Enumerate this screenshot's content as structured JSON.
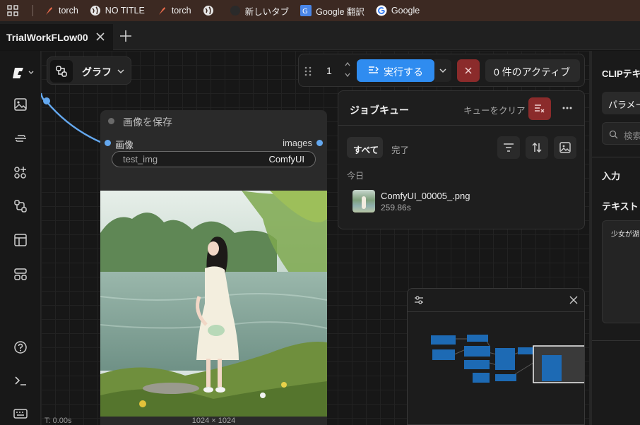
{
  "bookmarks": {
    "items": [
      {
        "label": "torch",
        "icon": "torch-favicon"
      },
      {
        "label": "NO TITLE",
        "icon": "globe-icon"
      },
      {
        "label": "torch",
        "icon": "torch-favicon"
      },
      {
        "label": "",
        "icon": "globe-icon"
      },
      {
        "label": "新しいタブ",
        "icon": "dark-circle-icon"
      },
      {
        "label": "Google 翻訳",
        "icon": "google-translate-icon"
      },
      {
        "label": "Google",
        "icon": "google-icon"
      }
    ]
  },
  "tab": {
    "title": "TrialWorkFLow00"
  },
  "toolbar": {
    "graph_label": "グラフ",
    "run_count": "1",
    "run_label": "実行する",
    "active_label": "0 件のアクティブ"
  },
  "queue": {
    "title": "ジョブキュー",
    "clear_label": "キューをクリア",
    "filter_all": "すべて",
    "filter_done": "完了",
    "section_today": "今日",
    "job_name": "ComfyUI_00005_.png",
    "job_time": "259.86s"
  },
  "node": {
    "title": "画像を保存",
    "input_label": "画像",
    "output_label": "images",
    "field_name": "test_img",
    "field_value": "ComfyUI",
    "image_size": "1024 × 1024"
  },
  "status": {
    "time": "T: 0.00s"
  },
  "right_panel": {
    "title": "CLIPテキ",
    "params_label": "パラメー",
    "search_placeholder": "検索",
    "input_label": "入力",
    "text_label": "テキスト",
    "text_value": "少女が湖"
  },
  "colors": {
    "accent": "#2f8cf0",
    "danger": "#8b2b2b",
    "link": "#64a8ef"
  }
}
